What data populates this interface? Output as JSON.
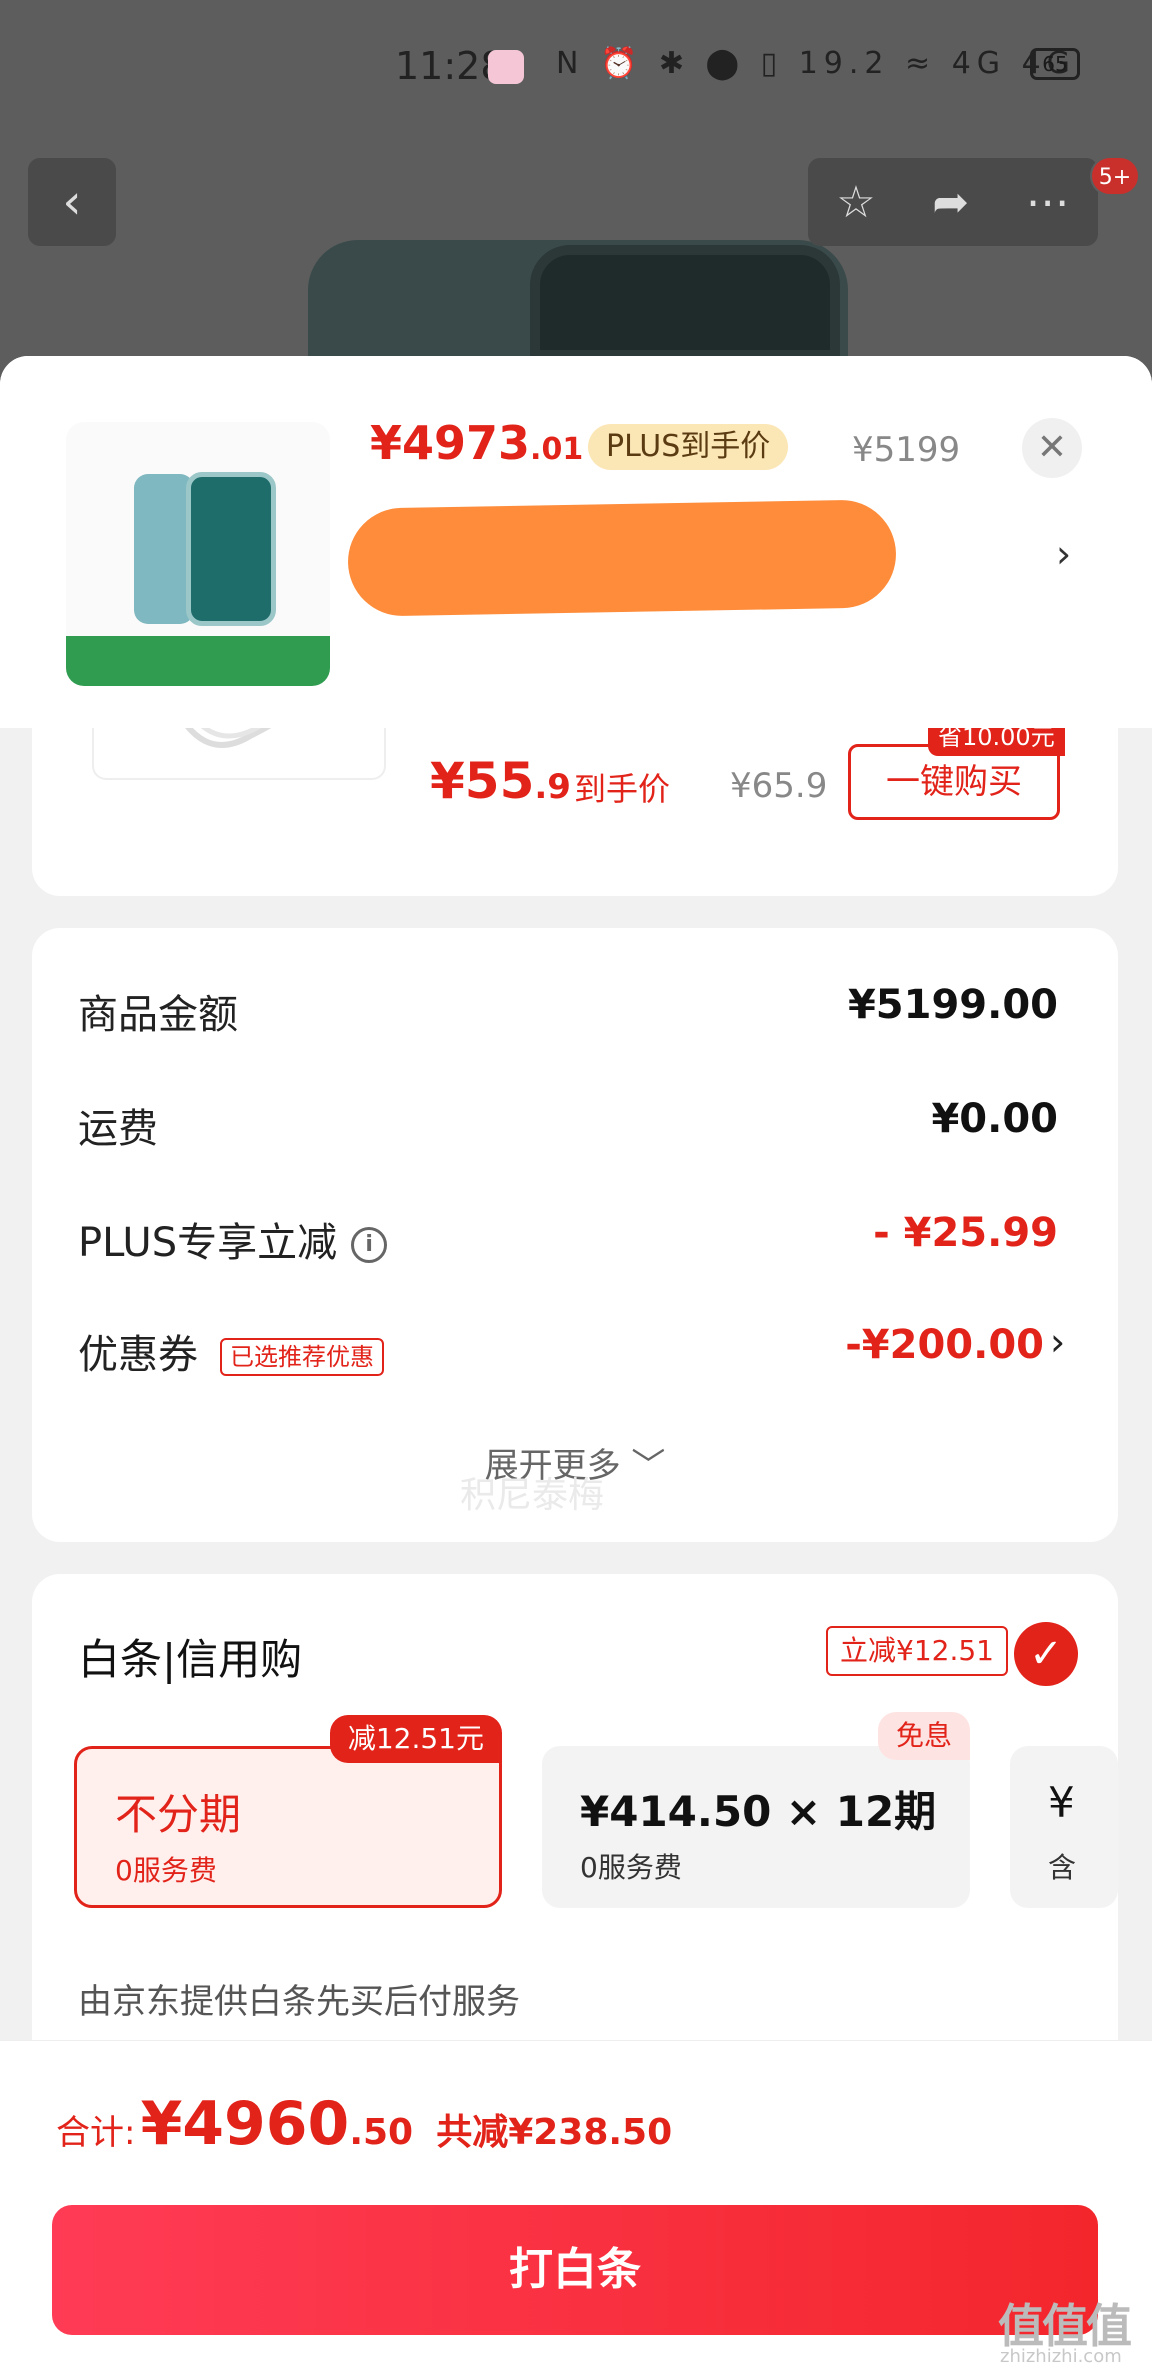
{
  "status_bar": {
    "time": "11:28",
    "icons": "N ⏰ ✱ ⬤ ▯ 19.2 ≈ 4G 4G",
    "battery": "65"
  },
  "top_actions": {
    "badge": "5+"
  },
  "product": {
    "price_main": "¥4973",
    "price_cents": ".01",
    "plus_tag": "PLUS到手价",
    "original_price": "¥5199"
  },
  "accessory": {
    "price_main": "¥55",
    "price_cents": ".9",
    "price_tag": "到手价",
    "original_price": "¥65.9",
    "buy_label": "一键购买",
    "save_tag": "省10.00元"
  },
  "amounts": {
    "rows": [
      {
        "label": "商品金额",
        "value": "¥5199.00"
      },
      {
        "label": "运费",
        "value": "¥0.00"
      },
      {
        "label": "PLUS专享立减",
        "value": "- ¥25.99"
      },
      {
        "label": "优惠券",
        "value": "-¥200.00",
        "tag": "已选推荐优惠"
      }
    ],
    "expand_label": "展开更多"
  },
  "baitiao": {
    "title": "白条|信用购",
    "discount_tag": "立减¥12.51",
    "options": [
      {
        "title": "不分期",
        "sub": "0服务费",
        "badge": "减12.51元"
      },
      {
        "title": "¥414.50 × 12期",
        "sub": "0服务费",
        "badge": "免息"
      },
      {
        "title": "¥",
        "sub": "含"
      }
    ],
    "note": "由京东提供白条先买后付服务"
  },
  "footer": {
    "total_label": "合计:",
    "total_main": "¥4960",
    "total_cents": ".50",
    "total_saved": "共减¥238.50",
    "pay_label": "打白条"
  },
  "watermark": {
    "main": "值值值",
    "url": "zhizhizhi.com",
    "center": "积尼泰梅"
  }
}
